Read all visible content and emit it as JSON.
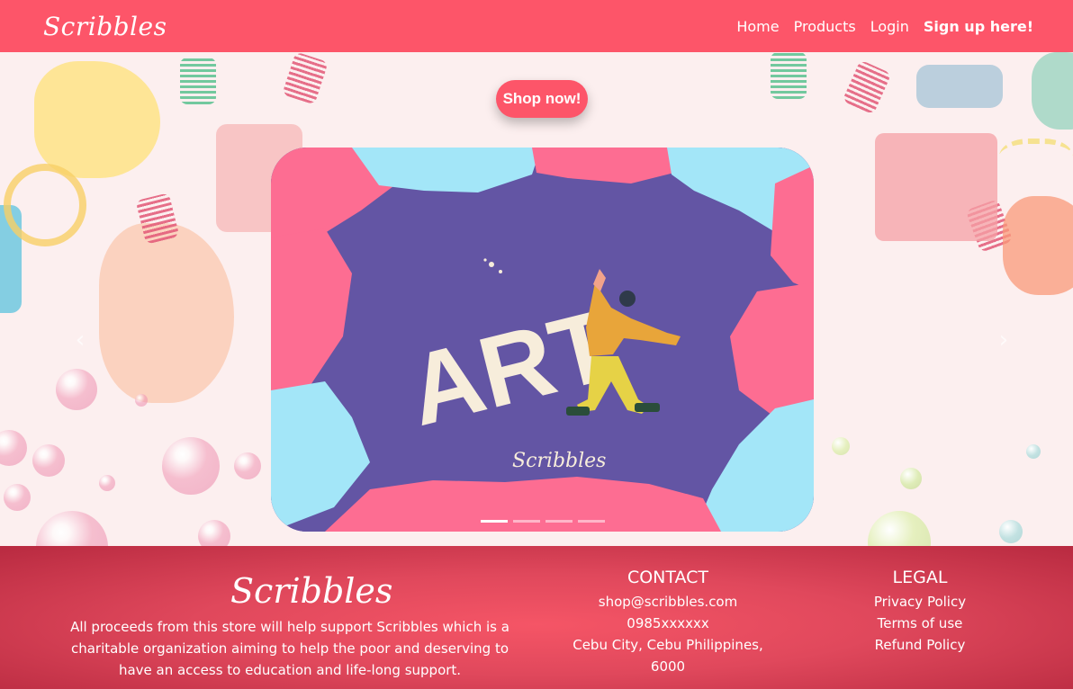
{
  "navbar": {
    "brand": "Scribbles",
    "links": [
      "Home",
      "Products",
      "Login",
      "Sign up here!"
    ]
  },
  "hero": {
    "shop_button": "Shop now!",
    "slide": {
      "art_text": "ART",
      "brand_text": "Scribbles"
    },
    "indicators": 4,
    "active_indicator": 0
  },
  "footer": {
    "brand": "Scribbles",
    "about": "All proceeds from this store will help support Scribbles which is a charitable organization aiming to help the poor and deserving to have an access to education and life-long support.",
    "contact": {
      "title": "CONTACT",
      "email": "shop@scribbles.com",
      "phone": "0985xxxxxx",
      "address": "Cebu City, Cebu Philippines, 6000"
    },
    "legal": {
      "title": "LEGAL",
      "links": [
        "Privacy Policy",
        "Terms of use",
        "Refund Policy"
      ]
    }
  },
  "colors": {
    "brand": "#fd5569",
    "slide_bg": "#6355a4",
    "slide_pink": "#fd6d92",
    "slide_blue": "#a3e6f8"
  }
}
